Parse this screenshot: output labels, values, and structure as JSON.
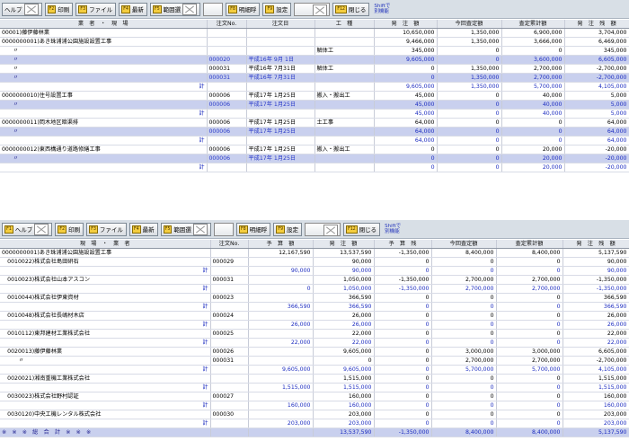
{
  "toolbar1": {
    "help": "ヘルプ",
    "print": "印刷",
    "file": "ファイル",
    "refresh": "最新",
    "select": "範囲選",
    "detail": "明細呼",
    "settings": "設定",
    "close": "閉じる",
    "shift1": "Shiftで",
    "shift2": "別機能"
  },
  "toolbar2": {
    "help": "ヘルプ",
    "print": "印刷",
    "file": "ファイル",
    "refresh": "最新",
    "select": "範囲選",
    "detail": "明細呼",
    "settings": "設定",
    "close": "閉じる",
    "shift1": "Shiftで",
    "shift2": "別機能"
  },
  "table1": {
    "headers": [
      "業　者　・　現　場",
      "注文No.",
      "注文日",
      "工　種",
      "発　注　額",
      "今回査定額",
      "査定累計額",
      "発　注　残　額"
    ],
    "rows": [
      {
        "cls": "grp",
        "name": "00001)藤伊藤林業",
        "no": "",
        "date": "",
        "kind": "",
        "c1": "10,650,000",
        "c2": "1,350,000",
        "c3": "6,900,000",
        "c4": "3,704,000"
      },
      {
        "cls": "grp",
        "name": "0000000001)あき珠浦浦公園施設設置工事",
        "no": "",
        "date": "",
        "kind": "",
        "c1": "9,466,000",
        "c2": "1,350,000",
        "c3": "3,666,000",
        "c4": "6,469,000"
      },
      {
        "cls": "grp",
        "name": "　　〃",
        "no": "",
        "date": "",
        "kind": "解体工",
        "c1": "345,000",
        "c2": "0",
        "c3": "0",
        "c4": "345,000"
      },
      {
        "cls": "blue",
        "name": "　　〃",
        "no": "000020",
        "date": "平成16年 9月 1日",
        "kind": "",
        "c1": "9,605,000",
        "c2": "0",
        "c3": "3,600,000",
        "c4": "6,605,000"
      },
      {
        "cls": "grp",
        "name": "　　〃",
        "no": "000031",
        "date": "平成16年 7月31日",
        "kind": "解体工",
        "c1": "0",
        "c2": "1,350,000",
        "c3": "2,700,000",
        "c4": "-2,700,000"
      },
      {
        "cls": "blue",
        "name": "　　〃",
        "no": "000031",
        "date": "平成16年 7月31日",
        "kind": "",
        "c1": "0",
        "c2": "1,350,000",
        "c3": "2,700,000",
        "c4": "-2,700,000"
      },
      {
        "cls": "kei",
        "name": "計",
        "no": "",
        "date": "",
        "kind": "",
        "c1": "9,605,000",
        "c2": "1,350,000",
        "c3": "5,700,000",
        "c4": "4,105,000"
      },
      {
        "cls": "grp",
        "name": "0000000010)住号設置工事",
        "no": "000006",
        "date": "平成17年 1月25日",
        "kind": "搬入・搬出工",
        "c1": "45,000",
        "c2": "0",
        "c3": "40,000",
        "c4": "5,000"
      },
      {
        "cls": "blue",
        "name": "　　〃",
        "no": "000006",
        "date": "平成17年 1月25日",
        "kind": "",
        "c1": "45,000",
        "c2": "0",
        "c3": "40,000",
        "c4": "5,000"
      },
      {
        "cls": "kei",
        "name": "計",
        "no": "",
        "date": "",
        "kind": "",
        "c1": "45,000",
        "c2": "0",
        "c3": "40,000",
        "c4": "5,000"
      },
      {
        "cls": "grp",
        "name": "0000000011)岡木地区暗渠排",
        "no": "000006",
        "date": "平成17年 1月25日",
        "kind": "土工事",
        "c1": "64,000",
        "c2": "0",
        "c3": "0",
        "c4": "64,000"
      },
      {
        "cls": "blue",
        "name": "　　〃",
        "no": "000006",
        "date": "平成17年 1月25日",
        "kind": "",
        "c1": "64,000",
        "c2": "0",
        "c3": "0",
        "c4": "64,000"
      },
      {
        "cls": "kei",
        "name": "計",
        "no": "",
        "date": "",
        "kind": "",
        "c1": "64,000",
        "c2": "0",
        "c3": "0",
        "c4": "64,000"
      },
      {
        "cls": "grp",
        "name": "0000000012)東西構通り道路修繕工事",
        "no": "000006",
        "date": "平成17年 1月25日",
        "kind": "搬入・搬出工",
        "c1": "0",
        "c2": "0",
        "c3": "20,000",
        "c4": "-20,000"
      },
      {
        "cls": "blue",
        "name": "　　〃",
        "no": "000006",
        "date": "平成17年 1月25日",
        "kind": "",
        "c1": "0",
        "c2": "0",
        "c3": "20,000",
        "c4": "-20,000"
      },
      {
        "cls": "kei",
        "name": "計",
        "no": "",
        "date": "",
        "kind": "",
        "c1": "0",
        "c2": "0",
        "c3": "20,000",
        "c4": "-20,000"
      }
    ]
  },
  "table2": {
    "headers": [
      "現　場　・　業　者",
      "注文No.",
      "予　算　額",
      "発　注　額",
      "予　算　残",
      "今回査定額",
      "査定累計額",
      "発　注　残　額"
    ],
    "rows": [
      {
        "cls": "grp",
        "name": "0000000001)あき珠浦浦公園施設設置工事",
        "no": "",
        "b": "12,167,590",
        "c1": "13,537,590",
        "d": "-1,350,000",
        "c2": "8,400,000",
        "c3": "8,400,000",
        "c4": "5,137,590"
      },
      {
        "cls": "grp",
        "name": "　0010022)株式会社島田研石",
        "no": "000029",
        "b": "",
        "c1": "90,000",
        "d": "0",
        "c2": "0",
        "c3": "0",
        "c4": "90,000"
      },
      {
        "cls": "kei",
        "name": "計",
        "no": "",
        "b": "90,000",
        "c1": "90,000",
        "d": "0",
        "c2": "0",
        "c3": "0",
        "c4": "90,000"
      },
      {
        "cls": "grp",
        "name": "　0010023)株式会社山本アスコン",
        "no": "000031",
        "b": "",
        "c1": "1,050,000",
        "d": "-1,350,000",
        "c2": "2,700,000",
        "c3": "2,700,000",
        "c4": "-1,350,000"
      },
      {
        "cls": "kei",
        "name": "計",
        "no": "",
        "b": "0",
        "c1": "1,050,000",
        "d": "-1,350,000",
        "c2": "2,700,000",
        "c3": "2,700,000",
        "c4": "-1,350,000"
      },
      {
        "cls": "grp",
        "name": "　0010044)株式会社伊東資材",
        "no": "000023",
        "b": "",
        "c1": "366,590",
        "d": "0",
        "c2": "0",
        "c3": "0",
        "c4": "366,590"
      },
      {
        "cls": "kei",
        "name": "計",
        "no": "",
        "b": "366,590",
        "c1": "366,590",
        "d": "0",
        "c2": "0",
        "c3": "0",
        "c4": "366,590"
      },
      {
        "cls": "grp",
        "name": "　0010048)株式会社長嶋材木店",
        "no": "000024",
        "b": "",
        "c1": "26,000",
        "d": "0",
        "c2": "0",
        "c3": "0",
        "c4": "26,000"
      },
      {
        "cls": "kei",
        "name": "計",
        "no": "",
        "b": "26,000",
        "c1": "26,000",
        "d": "0",
        "c2": "0",
        "c3": "0",
        "c4": "26,000"
      },
      {
        "cls": "grp",
        "name": "　0010112)東邦建材工業株式会社",
        "no": "000025",
        "b": "",
        "c1": "22,000",
        "d": "0",
        "c2": "0",
        "c3": "0",
        "c4": "22,000"
      },
      {
        "cls": "kei",
        "name": "計",
        "no": "",
        "b": "22,000",
        "c1": "22,000",
        "d": "0",
        "c2": "0",
        "c3": "0",
        "c4": "22,000"
      },
      {
        "cls": "grp",
        "name": "　0020013)藤伊藤林業",
        "no": "000026",
        "b": "",
        "c1": "9,605,000",
        "d": "0",
        "c2": "3,000,000",
        "c3": "3,000,000",
        "c4": "6,605,000"
      },
      {
        "cls": "grp",
        "name": "　　　〃",
        "no": "000031",
        "b": "",
        "c1": "0",
        "d": "0",
        "c2": "2,700,000",
        "c3": "2,700,000",
        "c4": "-2,700,000"
      },
      {
        "cls": "kei",
        "name": "計",
        "no": "",
        "b": "9,605,000",
        "c1": "9,605,000",
        "d": "0",
        "c2": "5,700,000",
        "c3": "5,700,000",
        "c4": "4,105,000"
      },
      {
        "cls": "grp",
        "name": "　0020021)湘南重機工業株式会社",
        "no": "",
        "b": "",
        "c1": "1,515,000",
        "d": "0",
        "c2": "0",
        "c3": "0",
        "c4": "1,515,000"
      },
      {
        "cls": "kei",
        "name": "計",
        "no": "",
        "b": "1,515,000",
        "c1": "1,515,000",
        "d": "0",
        "c2": "0",
        "c3": "0",
        "c4": "1,515,000"
      },
      {
        "cls": "grp",
        "name": "　0030023)株式会社野村認証",
        "no": "000027",
        "b": "",
        "c1": "160,000",
        "d": "0",
        "c2": "0",
        "c3": "0",
        "c4": "160,000"
      },
      {
        "cls": "kei",
        "name": "計",
        "no": "",
        "b": "160,000",
        "c1": "160,000",
        "d": "0",
        "c2": "0",
        "c3": "0",
        "c4": "160,000"
      },
      {
        "cls": "grp",
        "name": "　0030120)中央工機レンタル株式会社",
        "no": "000030",
        "b": "",
        "c1": "203,000",
        "d": "0",
        "c2": "0",
        "c3": "0",
        "c4": "203,000"
      },
      {
        "cls": "kei",
        "name": "計",
        "no": "",
        "b": "203,000",
        "c1": "203,000",
        "d": "0",
        "c2": "0",
        "c3": "0",
        "c4": "203,000"
      },
      {
        "cls": "blue",
        "name": "※　※　※　総　合　計　※　※　※",
        "no": "",
        "b": "",
        "c1": "13,537,590",
        "d": "-1,350,000",
        "c2": "8,400,000",
        "c3": "8,400,000",
        "c4": "5,137,590"
      }
    ]
  }
}
